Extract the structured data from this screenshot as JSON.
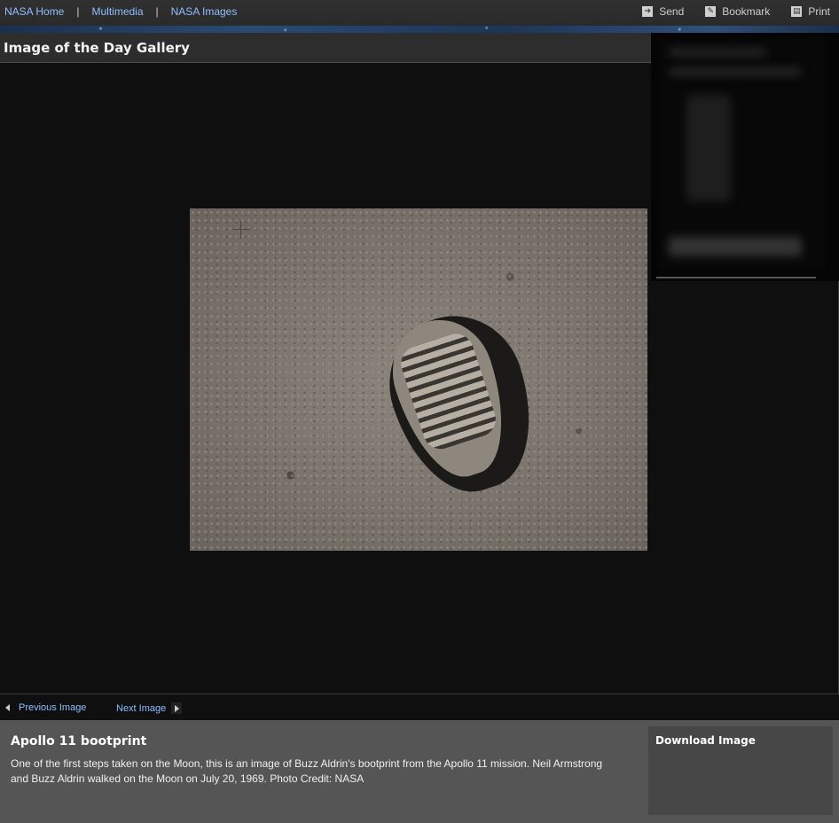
{
  "header": {
    "nav": [
      {
        "label": "NASA Home"
      },
      {
        "label": "Multimedia"
      },
      {
        "label": "NASA Images"
      }
    ],
    "separator": "|",
    "tools": [
      {
        "label": "Send",
        "icon": "send-icon"
      },
      {
        "label": "Bookmark",
        "icon": "bookmark-icon"
      },
      {
        "label": "Print",
        "icon": "print-icon"
      }
    ]
  },
  "gallery": {
    "title": "Image of the Day Gallery"
  },
  "pager": {
    "previous_label": "Previous Image",
    "next_label": "Next Image"
  },
  "caption": {
    "title": "Apollo 11 bootprint",
    "text": "One of the first steps taken on the Moon, this is an image of Buzz Aldrin's bootprint from the Apollo 11 mission. Neil Armstrong and Buzz Aldrin walked on the Moon on July 20, 1969. Photo Credit: NASA"
  },
  "download": {
    "label": "Download Image"
  },
  "colors": {
    "link": "#8fbfff",
    "caption_bg": "#555555",
    "stage_bg": "#0f0f0f"
  }
}
